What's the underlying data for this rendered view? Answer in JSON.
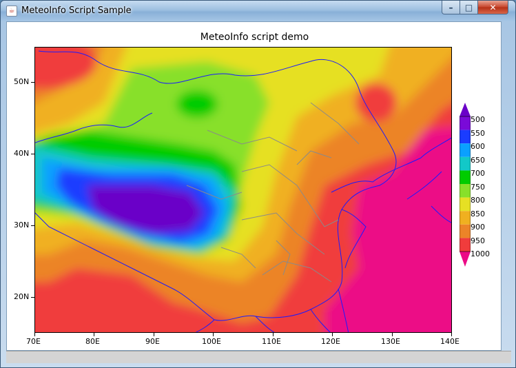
{
  "window": {
    "title": "MeteoInfo Script Sample",
    "controls": {
      "minimize": "–",
      "maximize": "□",
      "close": "✕"
    }
  },
  "plot": {
    "title": "MeteoInfo script demo",
    "x_ticks": [
      "70E",
      "80E",
      "90E",
      "100E",
      "110E",
      "120E",
      "130E",
      "140E"
    ],
    "y_ticks": [
      "50N",
      "40N",
      "30N",
      "20N"
    ]
  },
  "legend": {
    "levels": [
      "500",
      "550",
      "600",
      "650",
      "700",
      "750",
      "800",
      "850",
      "900",
      "950",
      "1000"
    ],
    "colors": [
      "#6a00c8",
      "#7a0ad8",
      "#1a3cff",
      "#0aa0ff",
      "#12c8c8",
      "#00cc00",
      "#88e02a",
      "#e6e024",
      "#f0b020",
      "#ec8428",
      "#f03c3c",
      "#ec0a86"
    ]
  },
  "chart_data": {
    "type": "heatmap",
    "title": "MeteoInfo script demo",
    "xlabel": "",
    "ylabel": "",
    "xlim": [
      70,
      140
    ],
    "ylim": [
      15,
      55
    ],
    "x_tick_labels": [
      "70E",
      "80E",
      "90E",
      "100E",
      "110E",
      "120E",
      "130E",
      "140E"
    ],
    "y_tick_labels": [
      "50N",
      "40N",
      "30N",
      "20N"
    ],
    "contour_levels": [
      500,
      550,
      600,
      650,
      700,
      750,
      800,
      850,
      900,
      950,
      1000
    ],
    "legend": "right"
  }
}
